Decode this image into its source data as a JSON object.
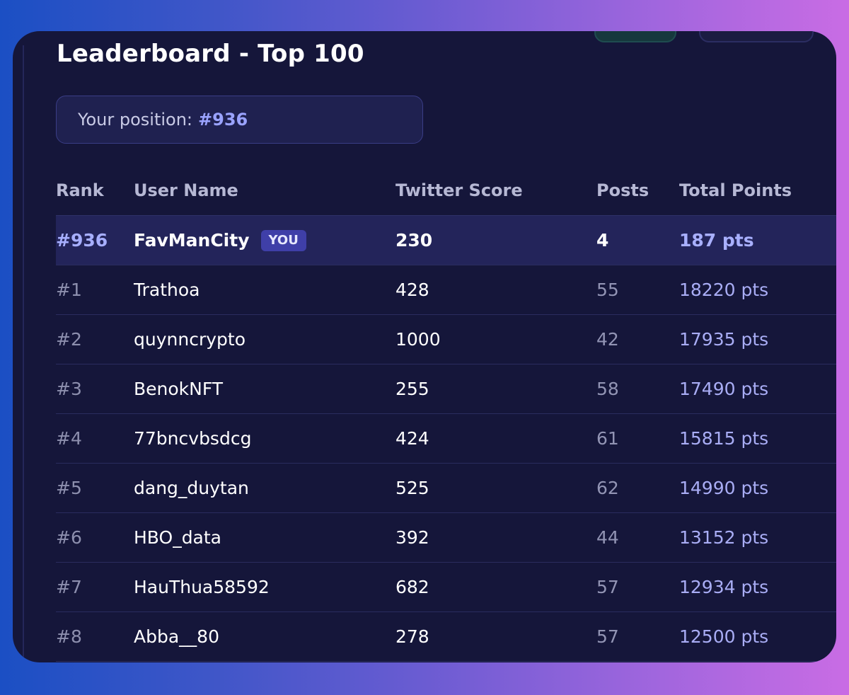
{
  "title": "Leaderboard - Top 100",
  "position": {
    "label": "Your position:",
    "value": "#936"
  },
  "table": {
    "headers": {
      "rank": "Rank",
      "user": "User Name",
      "score": "Twitter Score",
      "posts": "Posts",
      "total": "Total Points"
    },
    "you_badge": "YOU",
    "current_user": {
      "rank": "#936",
      "user": "FavManCity",
      "score": "230",
      "posts": "4",
      "total": "187 pts"
    },
    "rows": [
      {
        "rank": "#1",
        "user": "Trathoa",
        "score": "428",
        "posts": "55",
        "total": "18220 pts"
      },
      {
        "rank": "#2",
        "user": "quynncrypto",
        "score": "1000",
        "posts": "42",
        "total": "17935 pts"
      },
      {
        "rank": "#3",
        "user": "BenokNFT",
        "score": "255",
        "posts": "58",
        "total": "17490 pts"
      },
      {
        "rank": "#4",
        "user": "77bncvbsdcg",
        "score": "424",
        "posts": "61",
        "total": "15815 pts"
      },
      {
        "rank": "#5",
        "user": "dang_duytan",
        "score": "525",
        "posts": "62",
        "total": "14990 pts"
      },
      {
        "rank": "#6",
        "user": "HBO_data",
        "score": "392",
        "posts": "44",
        "total": "13152 pts"
      },
      {
        "rank": "#7",
        "user": "HauThua58592",
        "score": "682",
        "posts": "57",
        "total": "12934 pts"
      },
      {
        "rank": "#8",
        "user": "Abba__80",
        "score": "278",
        "posts": "57",
        "total": "12500 pts"
      }
    ]
  },
  "colors": {
    "background_start": "#1b4fc4",
    "background_end": "#c96ce4",
    "card": "#15163a",
    "accent": "#9aa3ff",
    "highlight_row": "#23245a",
    "badge": "#3f3fa8"
  }
}
